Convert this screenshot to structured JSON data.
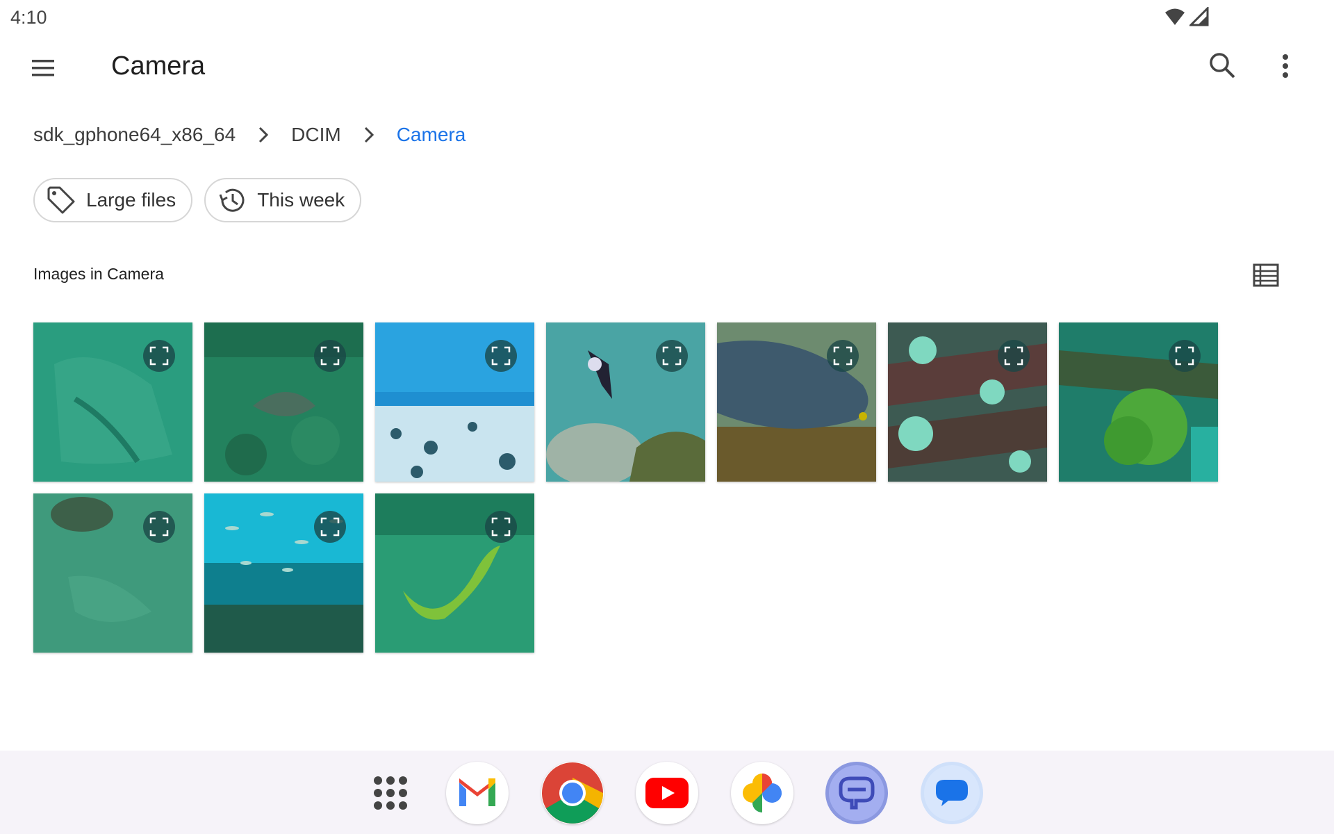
{
  "status_bar": {
    "time": "4:10"
  },
  "app_bar": {
    "title": "Camera"
  },
  "breadcrumb": [
    "sdk_gphone64_x86_64",
    "DCIM",
    "Camera"
  ],
  "chips": [
    {
      "label": "Large files",
      "icon": "tag-icon"
    },
    {
      "label": "This week",
      "icon": "history-icon"
    }
  ],
  "section": {
    "title": "Images in Camera"
  },
  "images": [
    {
      "icon": "expand-icon"
    },
    {
      "icon": "expand-icon"
    },
    {
      "icon": "expand-icon"
    },
    {
      "icon": "expand-icon"
    },
    {
      "icon": "expand-icon"
    },
    {
      "icon": "expand-icon"
    },
    {
      "icon": "expand-icon"
    },
    {
      "icon": "expand-icon"
    },
    {
      "icon": "expand-icon"
    },
    {
      "icon": "expand-icon"
    }
  ],
  "dock": [
    {
      "name": "app-drawer-icon"
    },
    {
      "name": "gmail-icon"
    },
    {
      "name": "chrome-icon"
    },
    {
      "name": "youtube-icon"
    },
    {
      "name": "photos-icon"
    },
    {
      "name": "app-icon"
    },
    {
      "name": "messages-icon"
    }
  ],
  "colors": {
    "accent": "#1a73e8",
    "dock_bg": "#f6f3f9"
  }
}
